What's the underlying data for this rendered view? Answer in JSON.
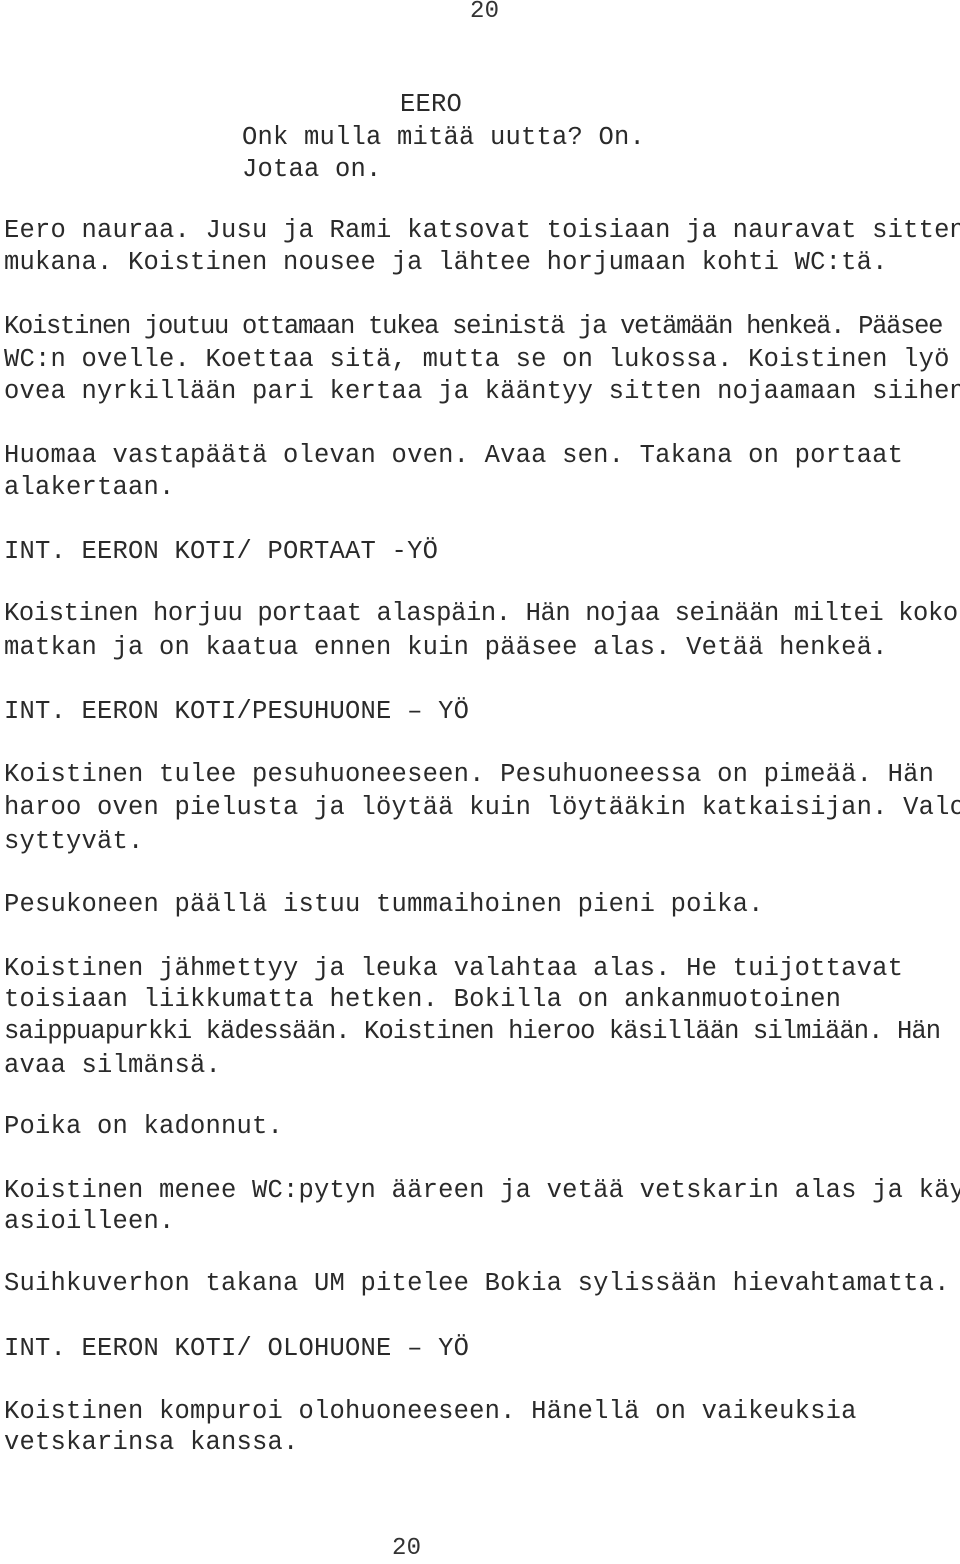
{
  "page_number_top": "20",
  "page_number_bottom": "20",
  "blocks": {
    "character_eero": "EERO",
    "dialogue_1": "Onk mulla mitää uutta? On.",
    "dialogue_2": "Jotaa on.",
    "action_1_l1": "Eero nauraa. Jusu ja Rami katsovat toisiaan ja nauravat sitten",
    "action_1_l2": "mukana. Koistinen nousee ja lähtee horjumaan kohti WC:tä.",
    "action_2_l1": "Koistinen joutuu ottamaan tukea seinistä ja vetämään henkeä. Pääsee",
    "action_2_l2": "WC:n ovelle. Koettaa sitä, mutta se on lukossa. Koistinen lyö",
    "action_2_l3": "ovea nyrkillään pari kertaa ja kääntyy sitten nojaamaan siihen.",
    "action_3_l1": "Huomaa vastapäätä olevan oven. Avaa sen. Takana on portaat",
    "action_3_l2": "alakertaan.",
    "scene_1": "INT. EERON KOTI/ PORTAAT -YÖ",
    "action_4_l1": "Koistinen horjuu portaat alaspäin. Hän nojaa seinään miltei koko",
    "action_4_l2": "matkan ja on kaatua ennen kuin pääsee alas. Vetää henkeä.",
    "scene_2": "INT. EERON KOTI/PESUHUONE – YÖ",
    "action_5_l1": "Koistinen tulee pesuhuoneeseen. Pesuhuoneessa on pimeää. Hän",
    "action_5_l2": "haroo oven pielusta ja löytää kuin löytääkin katkaisijan. Valot",
    "action_5_l3": "syttyvät.",
    "action_6": "Pesukoneen päällä istuu tummaihoinen pieni poika.",
    "action_7_l1": "Koistinen jähmettyy ja leuka valahtaa alas. He tuijottavat",
    "action_7_l2": "toisiaan liikkumatta hetken. Bokilla on ankanmuotoinen",
    "action_7_l3": "saippuapurkki kädessään. Koistinen hieroo käsillään silmiään. Hän",
    "action_7_l4": "avaa silmänsä.",
    "action_8": "Poika on kadonnut.",
    "action_9_l1": "Koistinen menee WC:pytyn ääreen ja vetää vetskarin alas ja käy",
    "action_9_l2": "asioilleen.",
    "action_10": "Suihkuverhon takana UM pitelee Bokia sylissään hievahtamatta.",
    "scene_3": "INT. EERON KOTI/ OLOHUONE – YÖ",
    "action_11_l1": "Koistinen kompuroi olohuoneeseen. Hänellä on vaikeuksia",
    "action_11_l2": "vetskarinsa kanssa."
  }
}
